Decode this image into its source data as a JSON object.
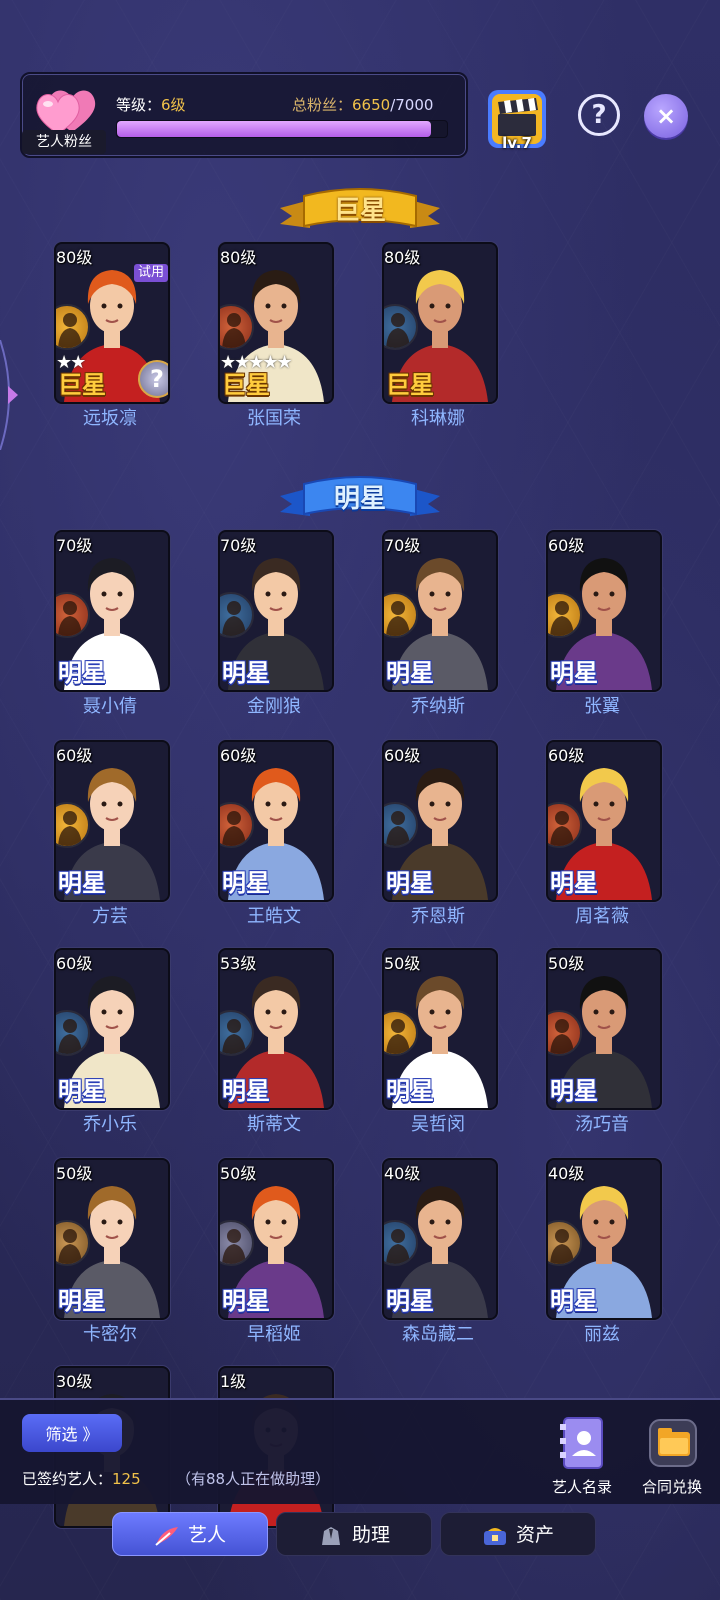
{
  "header": {
    "fan_tag": "艺人粉丝",
    "level_label": "等级：",
    "level_value": "6级",
    "fans_label": "总粉丝：",
    "fans_current": "6650",
    "fans_max": "/7000",
    "fans_progress": 0.95,
    "clapper_level": "lv.7",
    "help_icon": "?",
    "close_icon": "×"
  },
  "sections": {
    "superstar_title": "巨星",
    "star_title": "明星"
  },
  "superstars": [
    {
      "level": "80级",
      "name": "远坂凛",
      "rank": "巨星",
      "badge": "gold",
      "stars": 2,
      "trial": "试用",
      "hint": "?"
    },
    {
      "level": "80级",
      "name": "张国荣",
      "rank": "巨星",
      "badge": "red",
      "stars": 5
    },
    {
      "level": "80级",
      "name": "科琳娜",
      "rank": "巨星",
      "badge": "blue",
      "stars": 0
    }
  ],
  "stars": [
    {
      "level": "70级",
      "name": "聂小倩",
      "rank": "明星",
      "badge": "red"
    },
    {
      "level": "70级",
      "name": "金刚狼",
      "rank": "明星",
      "badge": "blue"
    },
    {
      "level": "70级",
      "name": "乔纳斯",
      "rank": "明星",
      "badge": "gold"
    },
    {
      "level": "60级",
      "name": "张翼",
      "rank": "明星",
      "badge": "gold"
    },
    {
      "level": "60级",
      "name": "方芸",
      "rank": "明星",
      "badge": "gold"
    },
    {
      "level": "60级",
      "name": "王皓文",
      "rank": "明星",
      "badge": "red"
    },
    {
      "level": "60级",
      "name": "乔恩斯",
      "rank": "明星",
      "badge": "blue"
    },
    {
      "level": "60级",
      "name": "周茗薇",
      "rank": "明星",
      "badge": "red"
    },
    {
      "level": "60级",
      "name": "乔小乐",
      "rank": "明星",
      "badge": "blue"
    },
    {
      "level": "53级",
      "name": "斯蒂文",
      "rank": "明星",
      "badge": "blue"
    },
    {
      "level": "50级",
      "name": "吴哲闵",
      "rank": "明星",
      "badge": "gold"
    },
    {
      "level": "50级",
      "name": "汤巧音",
      "rank": "明星",
      "badge": "red"
    },
    {
      "level": "50级",
      "name": "卡密尔",
      "rank": "明星",
      "badge": "tan"
    },
    {
      "level": "50级",
      "name": "早稻姬",
      "rank": "明星",
      "badge": "grey"
    },
    {
      "level": "40级",
      "name": "森岛藏二",
      "rank": "明星",
      "badge": "blue"
    },
    {
      "level": "40级",
      "name": "丽兹",
      "rank": "明星",
      "badge": "tan"
    },
    {
      "level": "30级",
      "name": "",
      "rank": "",
      "badge": "none"
    },
    {
      "level": "1级",
      "name": "",
      "rank": "",
      "badge": "none"
    }
  ],
  "bottom": {
    "filter_label": "筛选 》",
    "signed_label": "已签约艺人：",
    "signed_count": "125",
    "assist_note": "（有88人正在做助理）",
    "roster_label": "艺人名录",
    "contract_label": "合同兑换"
  },
  "tabs": [
    {
      "label": "艺人",
      "icon": "feather-icon",
      "active": true
    },
    {
      "label": "助理",
      "icon": "suit-icon",
      "active": false
    },
    {
      "label": "资产",
      "icon": "gem-icon",
      "active": false
    }
  ],
  "colors": {
    "gold_text": "#f1c24a",
    "name_text": "#8fb6ff",
    "progress_fill": "#b35ee8",
    "active_tab": "#5a66f0"
  }
}
